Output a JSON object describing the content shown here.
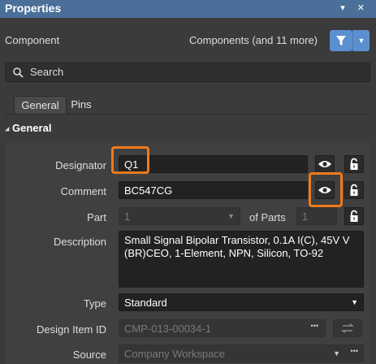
{
  "panel": {
    "title": "Properties",
    "title_icons": "▾ ✕"
  },
  "filter": {
    "label": "Component",
    "selection": "Components (and 11 more)"
  },
  "search": {
    "placeholder": "Search"
  },
  "tabs": [
    {
      "label": "General",
      "active": true
    },
    {
      "label": "Pins",
      "active": false
    }
  ],
  "section": {
    "label": "General",
    "collapse_glyph": "◢"
  },
  "fields": {
    "designator": {
      "label": "Designator",
      "value": "Q1"
    },
    "comment": {
      "label": "Comment",
      "value": "BC547CG"
    },
    "part": {
      "label": "Part",
      "value": "1",
      "of_label": "of Parts",
      "of_value": "1"
    },
    "description": {
      "label": "Description",
      "value": "Small Signal Bipolar Transistor, 0.1A I(C), 45V V (BR)CEO, 1-Element, NPN, Silicon, TO-92"
    },
    "type": {
      "label": "Type",
      "value": "Standard"
    },
    "design_item_id": {
      "label": "Design Item ID",
      "value": "CMP-013-00034-1",
      "dots": "•••"
    },
    "source": {
      "label": "Source",
      "value": "Company Workspace",
      "dots": "•••"
    }
  },
  "colors": {
    "titlebar": "#4a6f99",
    "accent": "#5b8fd0",
    "highlight": "#f07a1a"
  }
}
